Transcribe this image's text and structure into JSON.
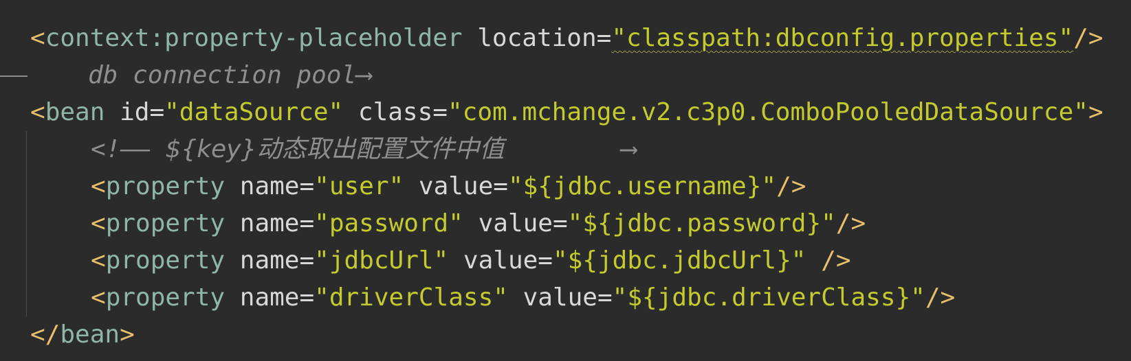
{
  "editor": {
    "lines": [
      {
        "open": "<",
        "tag": "context:property-placeholder",
        "attr1": "location",
        "eq1": "=",
        "val1": "\"classpath:dbconfig.properties\"",
        "close": "/>"
      },
      {
        "comment": "db connection pool",
        "comment_end": "⟶"
      },
      {
        "open": "<",
        "tag": "bean",
        "attr1": "id",
        "eq1": "=",
        "val1": "\"dataSource\"",
        "attr2": "class",
        "eq2": "=",
        "val2": "\"com.mchange.v2.c3p0.ComboPooledDataSource\"",
        "close": ">"
      },
      {
        "comment_start": "<!——",
        "comment": "${key}动态取出配置文件中值",
        "comment_end": "⟶"
      },
      {
        "open": "<",
        "tag": "property",
        "attr1": "name",
        "eq1": "=",
        "val1": "\"user\"",
        "attr2": "value",
        "eq2": "=",
        "val2": "\"${jdbc.username}\"",
        "close": "/>"
      },
      {
        "open": "<",
        "tag": "property",
        "attr1": "name",
        "eq1": "=",
        "val1": "\"password\"",
        "attr2": "value",
        "eq2": "=",
        "val2": "\"${jdbc.password}\"",
        "close": "/>"
      },
      {
        "open": "<",
        "tag": "property",
        "attr1": "name",
        "eq1": "=",
        "val1": "\"jdbcUrl\"",
        "attr2": "value",
        "eq2": "=",
        "val2": "\"${jdbc.jdbcUrl}\"",
        "close": "/>"
      },
      {
        "open": "<",
        "tag": "property",
        "attr1": "name",
        "eq1": "=",
        "val1": "\"driverClass\"",
        "attr2": "value",
        "eq2": "=",
        "val2": "\"${jdbc.driverClass}\"",
        "close": "/>"
      },
      {
        "open": "</",
        "tag": "bean",
        "close": ">"
      }
    ]
  },
  "colors": {
    "background": "#2b2b2b",
    "punctuation": "#e8bf6a",
    "tag": "#8fb6a6",
    "attribute": "#d8d8d8",
    "string": "#c3cb2f",
    "comment": "#8e8e8e"
  }
}
